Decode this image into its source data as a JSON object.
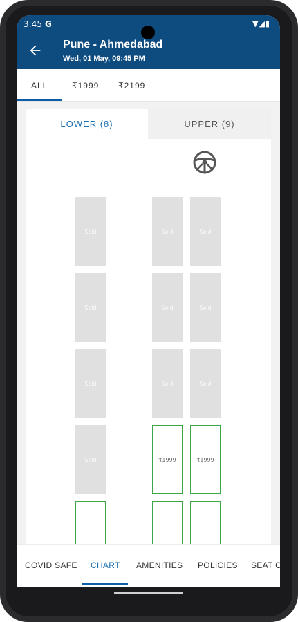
{
  "status_bar": {
    "time": "3:45",
    "g_badge": "G",
    "icons": "▼◢▮"
  },
  "header": {
    "route": "Pune - Ahmedabad",
    "date": "Wed, 01 May,  09:45 PM",
    "bg_color": "#0e4c80"
  },
  "price_tabs": [
    {
      "label": "ALL",
      "active": true
    },
    {
      "label": "₹1999",
      "active": false
    },
    {
      "label": "₹2199",
      "active": false
    }
  ],
  "deck_tabs": {
    "lower": "LOWER (8)",
    "upper": "UPPER (9)"
  },
  "seats": {
    "sold_label": "Sold",
    "rows": [
      {
        "left": "Sold",
        "right1": "Sold",
        "right2": "Sold"
      },
      {
        "left": "Sold",
        "right1": "Sold",
        "right2": "Sold"
      },
      {
        "left": "Sold",
        "right1": "Sold",
        "right2": "Sold"
      },
      {
        "left": "Sold",
        "right1": "₹1999",
        "right2": "₹1999"
      },
      {
        "left": "",
        "right1": "",
        "right2": ""
      }
    ]
  },
  "bottom_tabs": [
    {
      "label": "COVID SAFE",
      "active": false
    },
    {
      "label": "CHART",
      "active": true
    },
    {
      "label": "AMENITIES",
      "active": false
    },
    {
      "label": "POLICIES",
      "active": false
    },
    {
      "label": "SEAT C",
      "active": false
    }
  ]
}
